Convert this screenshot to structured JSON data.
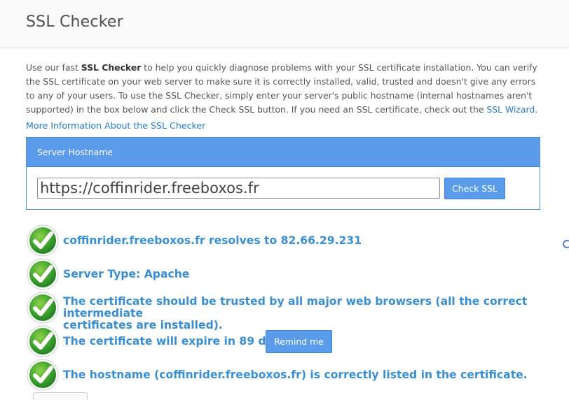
{
  "header": {
    "title": "SSL Checker"
  },
  "intro": {
    "part1": "Use our fast ",
    "bold": "SSL Checker",
    "part2": " to help you quickly diagnose problems with your SSL certificate installation. You can verify the SSL certificate on your web server to make sure it is correctly installed, valid, trusted and doesn't give any errors to any of your users. To use the SSL Checker, simply enter your server's public hostname (internal hostnames aren't supported) in the box below and click the Check SSL button. If you need an SSL certificate, check out the ",
    "link": "SSL Wizard",
    "part3": "."
  },
  "more_info_link": "More Information About the SSL Checker",
  "form": {
    "panel_title": "Server Hostname",
    "hostname_value": "https://coffinrider.freeboxos.fr",
    "check_button": "Check SSL"
  },
  "results": [
    {
      "text": "coffinrider.freeboxos.fr resolves to 82.66.29.231",
      "icon": "green-check-icon"
    },
    {
      "text": "Server Type: Apache",
      "icon": "green-check-icon"
    },
    {
      "line1": "The certificate should be trusted by all major web browsers (all the correct intermediate",
      "line2": "certificates are installed).",
      "icon": "green-check-icon"
    },
    {
      "text": "The certificate will expire in 89 days.",
      "button": "Remind me",
      "icon": "green-check-icon"
    },
    {
      "text": "The hostname (coffinrider.freeboxos.fr) is correctly listed in the certificate.",
      "icon": "green-check-icon"
    }
  ],
  "colors": {
    "accent": "#5b9cea",
    "result_text": "#3b8fd1",
    "check_green": "#3aa13a"
  }
}
